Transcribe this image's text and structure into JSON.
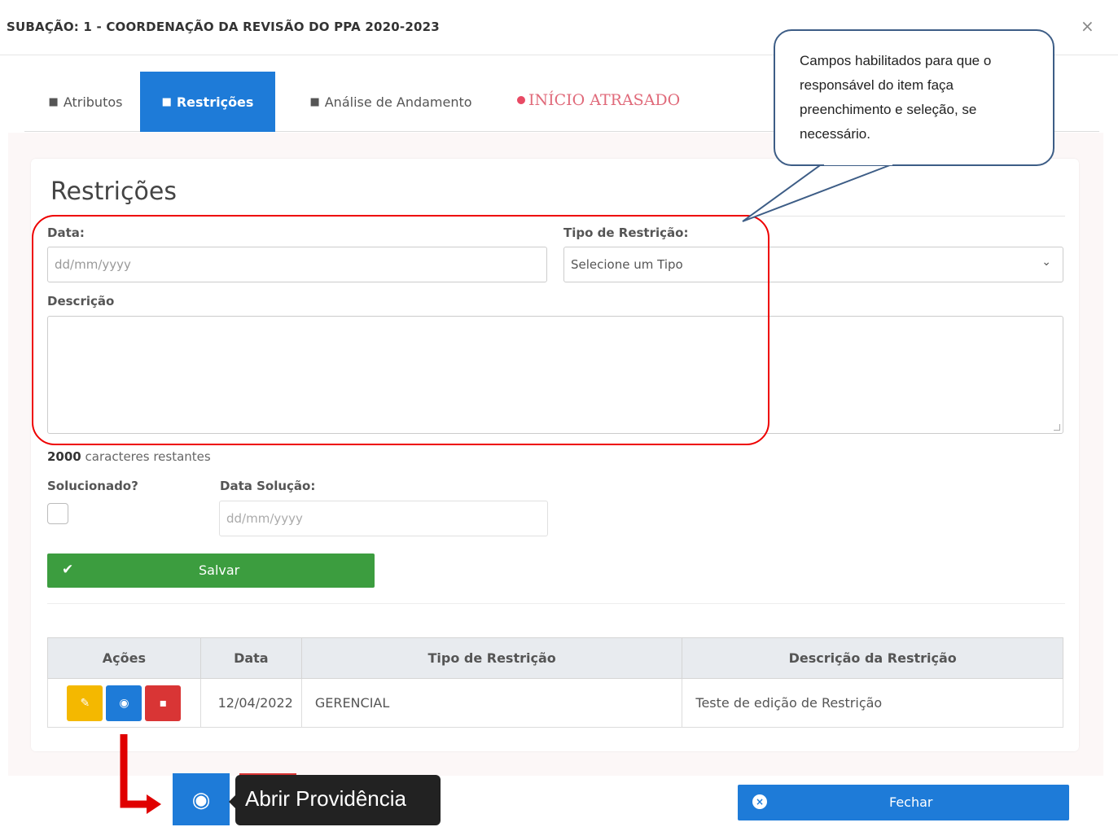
{
  "modal": {
    "title": "SUBAÇÃO: 1 - COORDENAÇÃO DA REVISÃO DO PPA 2020-2023",
    "close": "×"
  },
  "tabs": [
    {
      "label": "Atributos",
      "icon": "person-icon",
      "active": false
    },
    {
      "label": "Restrições",
      "icon": "person-icon",
      "active": true
    },
    {
      "label": "Análise de Andamento",
      "icon": "person-icon",
      "active": false
    }
  ],
  "status": {
    "label": "INÍCIO  ATRASADO",
    "color": "#e84a64"
  },
  "form": {
    "section_title": "Restrições",
    "date_label": "Data:",
    "date_placeholder": "dd/mm/yyyy",
    "type_label": "Tipo de Restrição:",
    "type_selected": "Selecione um Tipo",
    "description_label": "Descrição",
    "counter_value": "2000",
    "counter_text": " caracteres restantes",
    "solved_label": "Solucionado?",
    "solution_date_label": "Data Solução:",
    "solution_date_placeholder": "dd/mm/yyyy",
    "save_label": "Salvar"
  },
  "table": {
    "headers": [
      "Ações",
      "Data",
      "Tipo de Restrição",
      "Descrição da Restrição"
    ],
    "rows": [
      {
        "date": "12/04/2022",
        "type": "GERENCIAL",
        "description": "Teste de edição de Restrição"
      }
    ]
  },
  "callout": {
    "text": "Campos habilitados para que o responsável do item faça preenchimento e seleção, se necessário."
  },
  "tooltip": {
    "label": "Abrir Providência"
  },
  "footer": {
    "close_label": "Fechar"
  },
  "colors": {
    "primary": "#1e7bd8",
    "success": "#3c9d3f",
    "warning": "#f4b800",
    "danger": "#d93535"
  }
}
